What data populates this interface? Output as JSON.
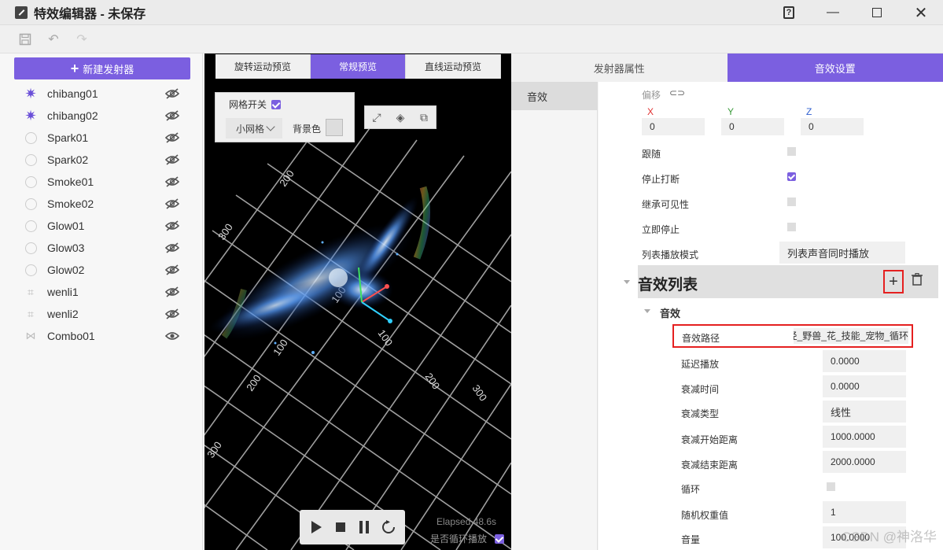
{
  "window": {
    "title": "特效编辑器 - 未保存"
  },
  "new_emitter_label": "新建发射器",
  "emitters": [
    {
      "name": "chibang01",
      "icon": "sparkle-icon",
      "visible": false
    },
    {
      "name": "chibang02",
      "icon": "sparkle-icon",
      "visible": false
    },
    {
      "name": "Spark01",
      "icon": "circle-icon",
      "visible": false
    },
    {
      "name": "Spark02",
      "icon": "circle-icon",
      "visible": false
    },
    {
      "name": "Smoke01",
      "icon": "circle-icon",
      "visible": false
    },
    {
      "name": "Smoke02",
      "icon": "circle-icon",
      "visible": false
    },
    {
      "name": "Glow01",
      "icon": "circle-icon",
      "visible": false
    },
    {
      "name": "Glow03",
      "icon": "circle-icon",
      "visible": false
    },
    {
      "name": "Glow02",
      "icon": "circle-icon",
      "visible": false
    },
    {
      "name": "wenli1",
      "icon": "grid-icon",
      "visible": false
    },
    {
      "name": "wenli2",
      "icon": "grid-icon",
      "visible": false
    },
    {
      "name": "Combo01",
      "icon": "combo-icon",
      "visible": true
    }
  ],
  "viewport": {
    "tabs": [
      "旋转运动预览",
      "常规预览",
      "直线运动预览"
    ],
    "active_tab": 1,
    "grid_toggle_label": "网格开关",
    "grid_enabled": true,
    "grid_size": "小网格",
    "bg_color_label": "背景色",
    "elapsed_text": "Elapsed  48.6s",
    "loop_label": "是否循环播放",
    "loop_enabled": true,
    "grid_labels": [
      "300",
      "200",
      "100",
      "100",
      "200",
      "300",
      "100",
      "200",
      "300"
    ]
  },
  "right_tabs": [
    "发射器属性",
    "音效设置"
  ],
  "right_active_tab": 1,
  "side_nav": [
    "音效"
  ],
  "props": {
    "offset_label": "偏移",
    "x_label": "X",
    "y_label": "Y",
    "z_label": "Z",
    "x_value": "0",
    "y_value": "0",
    "z_value": "0",
    "follow_label": "跟随",
    "stop_interrupt_label": "停止打断",
    "inherit_visibility_label": "继承可见性",
    "stop_immediately_label": "立即停止",
    "list_mode_label": "列表播放模式",
    "list_mode_value": "列表声音同时播放",
    "sound_list_title": "音效列表",
    "sound_group_title": "音效",
    "sound_path_label": "音效路径",
    "sound_path_value": "径_野兽_花_技能_宠物_循环_",
    "delay_label": "延迟播放",
    "delay_value": "0.0000",
    "fade_time_label": "衰减时间",
    "fade_time_value": "0.0000",
    "fade_type_label": "衰减类型",
    "fade_type_value": "线性",
    "fade_start_label": "衰减开始距离",
    "fade_start_value": "1000.0000",
    "fade_end_label": "衰减结束距离",
    "fade_end_value": "2000.0000",
    "loop_label": "循环",
    "random_weight_label": "随机权重值",
    "random_weight_value": "1",
    "volume_label": "音量",
    "volume_value": "100.0000"
  },
  "watermark": "CSDN @神洛华",
  "colors": {
    "accent": "#7b5fe0",
    "highlight": "#e52020"
  }
}
